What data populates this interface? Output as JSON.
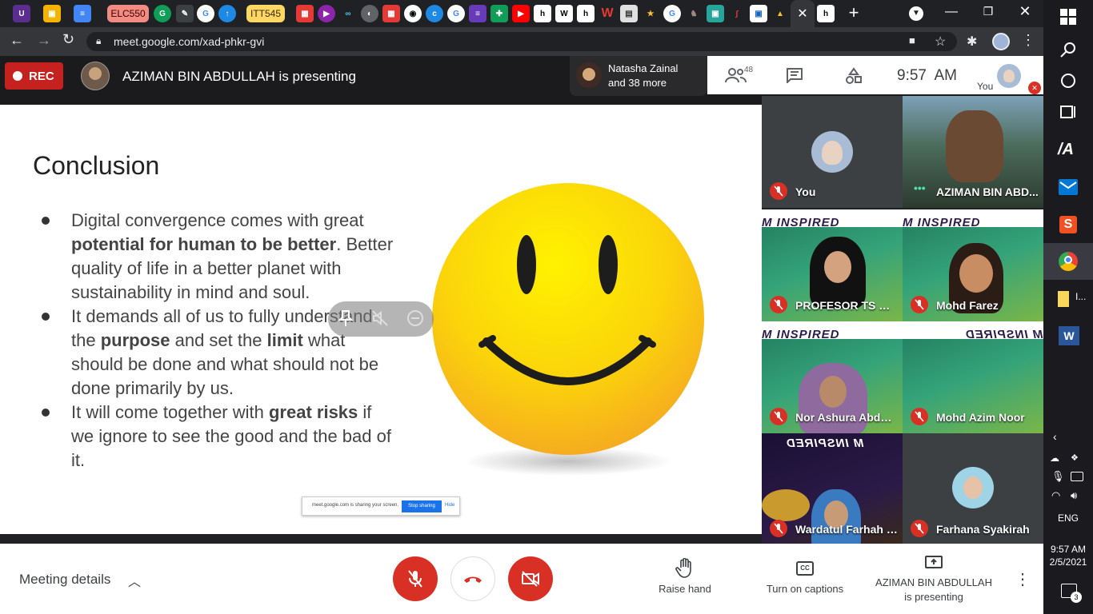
{
  "browser": {
    "tab_pills": [
      "ELC550",
      "ITT545"
    ],
    "url": "meet.google.com/xad-phkr-gvi"
  },
  "meet_header": {
    "rec_label": "REC",
    "presenter_text": "AZIMAN BIN ABDULLAH is presenting",
    "participant_preview": "Natasha Zainal\nand 38 more",
    "participant_preview_line1": "Natasha Zainal",
    "participant_preview_line2": "and 38 more",
    "participant_count": "48",
    "clock": "9:57  AM",
    "self_label": "You"
  },
  "slide": {
    "title": "Conclusion",
    "bullets": [
      {
        "parts": [
          [
            "Digital convergence comes with great ",
            false
          ],
          [
            "potential for human to be better",
            true
          ],
          [
            ". Better quality of life in a better planet with sustainability in mind and soul.",
            false
          ]
        ]
      },
      {
        "parts": [
          [
            "It demands all of us to fully understand the ",
            false
          ],
          [
            "purpose",
            true
          ],
          [
            " and set the ",
            false
          ],
          [
            "limit",
            true
          ],
          [
            " what should be done and what should not be done primarily by us.",
            false
          ]
        ]
      },
      {
        "parts": [
          [
            "It will come together with ",
            false
          ],
          [
            "great risks",
            true
          ],
          [
            " if we ignore to see the good and the bad of it.",
            false
          ]
        ]
      }
    ],
    "sharing_text": "meet.google.com is sharing your screen.",
    "stop_sharing": "Stop sharing",
    "hide": "Hide"
  },
  "participants": [
    {
      "name": "You"
    },
    {
      "name": "AZIMAN BIN ABD..."
    },
    {
      "name": "PROFESOR TS DR ..."
    },
    {
      "name": "Mohd Farez"
    },
    {
      "name": "Nor Ashura Abdul ..."
    },
    {
      "name": "Mohd Azim Noor"
    },
    {
      "name": "Wardatul Farhah N..."
    },
    {
      "name": "Farhana Syakirah"
    }
  ],
  "tile_banner_text": "M INSPIRED",
  "bottom": {
    "meeting_details": "Meeting details",
    "raise_hand": "Raise hand",
    "captions": "Turn on captions",
    "presenting_line1": "AZIMAN BIN ABDULLAH",
    "presenting_line2": "is presenting"
  },
  "taskbar": {
    "lang": "ENG",
    "time": "9:57 AM",
    "date": "2/5/2021",
    "notifications": "3",
    "pinned_label": "I..."
  },
  "colors": {
    "danger": "#d93025",
    "accent": "#1a73e8",
    "rec": "#c5221f"
  }
}
